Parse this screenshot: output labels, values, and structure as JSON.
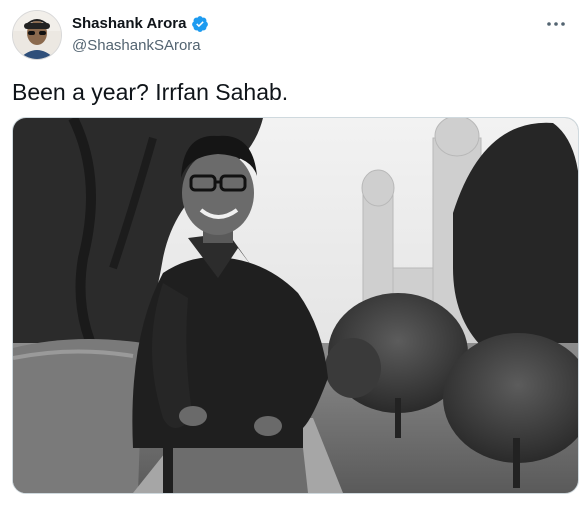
{
  "author": {
    "name": "Shashank Arora",
    "handle": "@ShashankSArora",
    "verified": true,
    "verified_color": "#1d9bf0"
  },
  "tweet": {
    "text": "Been a year? Irrfan Sahab."
  },
  "icons": {
    "verified": "verified-badge-icon",
    "more": "more-options-icon"
  },
  "media": {
    "alt": "Black and white photo of Irrfan Khan smiling in a garden"
  }
}
